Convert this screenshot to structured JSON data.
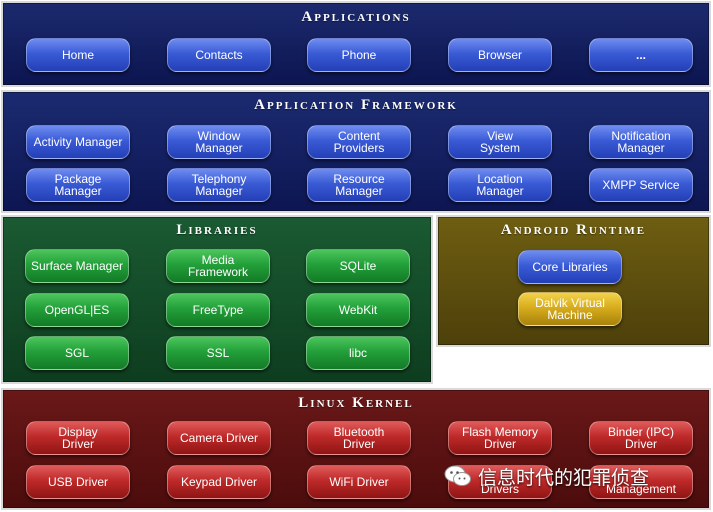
{
  "applications": {
    "title": "Applications",
    "items": [
      "Home",
      "Contacts",
      "Phone",
      "Browser",
      "..."
    ]
  },
  "framework": {
    "title": "Application Framework",
    "items": [
      "Activity Manager",
      "Window\nManager",
      "Content\nProviders",
      "View\nSystem",
      "Notification\nManager",
      "Package Manager",
      "Telephony\nManager",
      "Resource\nManager",
      "Location\nManager",
      "XMPP Service"
    ]
  },
  "libraries": {
    "title": "Libraries",
    "items": [
      "Surface Manager",
      "Media\nFramework",
      "SQLite",
      "OpenGL|ES",
      "FreeType",
      "WebKit",
      "SGL",
      "SSL",
      "libc"
    ]
  },
  "runtime": {
    "title": "Android Runtime",
    "items": [
      "Core Libraries",
      "Dalvik Virtual\nMachine"
    ]
  },
  "kernel": {
    "title": "Linux Kernel",
    "items": [
      "Display\nDriver",
      "Camera Driver",
      "Bluetooth\nDriver",
      "Flash Memory\nDriver",
      "Binder (IPC)\nDriver",
      "USB Driver",
      "Keypad Driver",
      "WiFi Driver",
      "Drivers",
      "Management"
    ]
  },
  "watermark": {
    "text": "信息时代的犯罪侦查",
    "icon": "wechat-icon"
  },
  "colors": {
    "applications_bg": "#0c1550",
    "libraries_bg": "#0e3d1f",
    "runtime_bg": "#4d400a",
    "kernel_bg": "#4c0c0c",
    "blue_button": "#3a5bd6",
    "green_button": "#23a03a",
    "red_button": "#bf2a2a",
    "yellow_button": "#d8ad1d"
  }
}
